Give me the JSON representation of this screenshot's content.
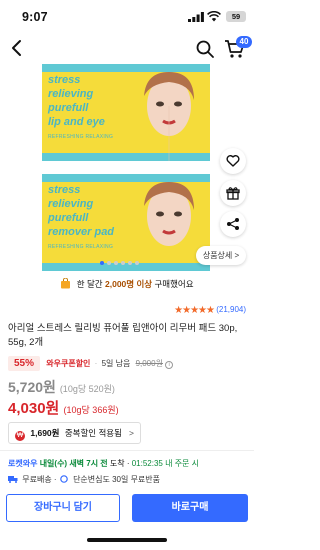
{
  "status": {
    "time": "9:07",
    "battery": "59"
  },
  "header": {
    "cart_count": "40"
  },
  "product_image": {
    "line1": "stress",
    "line2": "relieving",
    "line3": "purefull",
    "line4": "lip and eye",
    "line5": "remover pad",
    "small": "REFRESHING RELAXING"
  },
  "side": {
    "detail_label": "상품상세 >"
  },
  "purchase": {
    "prefix": "한 달간",
    "count": "2,000명 이상",
    "suffix": "구매했어요"
  },
  "rating": {
    "stars": "★★★★★",
    "count": "(21,904)"
  },
  "title": "아리얼 스트레스 릴리빙 퓨어풀 립앤아이 리무버 패드 30p, 55g, 2개",
  "price": {
    "discount": "55%",
    "coupon": "와우쿠폰할인",
    "separator": "·",
    "monthly": "5일 남음",
    "original": "9,000원",
    "old_price": "5,720원",
    "old_unit": "(10g당 520원)",
    "new_price": "4,030원",
    "new_unit": "(10g당 366원)"
  },
  "cashback": {
    "coin": "₩",
    "amount": "1,690원",
    "label": "중복할인 적용됨",
    "arrow": ">"
  },
  "delivery": {
    "rocket": "로켓와우",
    "date": "내일(수) 새벽 7시 전",
    "arrive": "도착 ·",
    "timer": "01:52:35",
    "suffix": "내 주문 시",
    "free_ship": "무료배송",
    "dot": "·",
    "return": "단순변심도 30일 무료반품"
  },
  "actions": {
    "cart": "장바구니 담기",
    "buy": "바로구매"
  },
  "colors": {
    "accent": "#346aff",
    "sale": "#d8262b",
    "green": "#0a8a3a"
  }
}
